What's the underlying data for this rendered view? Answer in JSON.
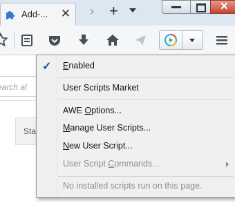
{
  "tab": {
    "title": "Add-...",
    "favicon": "puzzle-piece-icon",
    "close": "✕"
  },
  "tabbar": {
    "scroll_arrow": "›",
    "new_tab": "+",
    "window_close": "✕"
  },
  "toolbar": {
    "icons": [
      "star-icon",
      "reading-list-icon",
      "pocket-icon",
      "download-icon",
      "home-icon",
      "send-icon",
      "awe-extension-icon",
      "dropdown-arrow-icon",
      "hamburger-menu-icon"
    ]
  },
  "page": {
    "search_placeholder": "earch al",
    "side_panel_text": "Sta"
  },
  "menu": {
    "enabled": {
      "prefix": "",
      "accel": "E",
      "rest": "nabled",
      "checked": true
    },
    "market": "User Scripts Market",
    "awe_options": {
      "prefix": "AWE ",
      "accel": "O",
      "rest": "ptions..."
    },
    "manage": {
      "prefix": "",
      "accel": "M",
      "rest": "anage User Scripts..."
    },
    "new_script": {
      "prefix": "",
      "accel": "N",
      "rest": "ew User Script..."
    },
    "commands": {
      "prefix": "User Script ",
      "accel": "C",
      "rest": "ommands..."
    },
    "status": "No installed scripts run on this page."
  },
  "colors": {
    "accent": "#1f4fa0",
    "menu_bg": "#f0f0f0",
    "disabled_text": "#8d8d8d"
  }
}
